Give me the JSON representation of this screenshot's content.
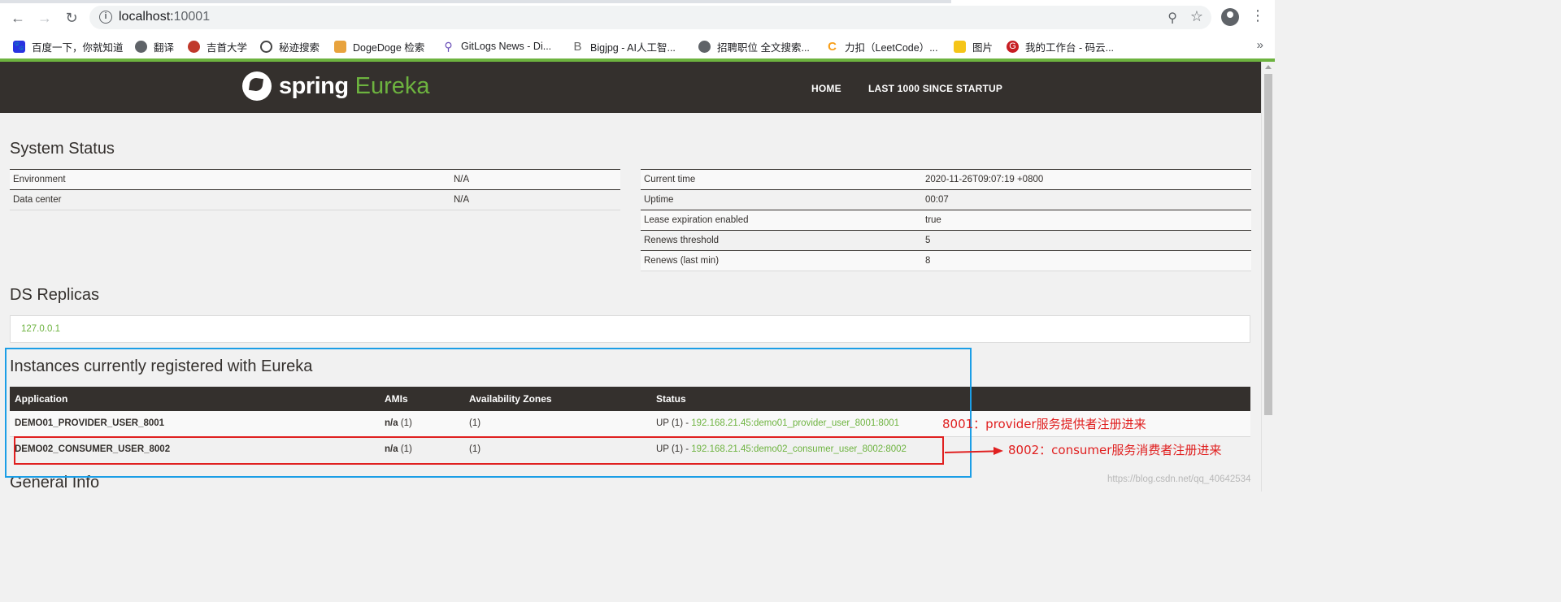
{
  "browser": {
    "url_host": "localhost:",
    "url_port": "10001",
    "bookmarks": [
      {
        "label": "百度一下，你就知道",
        "icon": "baidu-icon",
        "color": "#2932e1"
      },
      {
        "label": "翻译",
        "icon": "globe-icon",
        "color": "#5f6368"
      },
      {
        "label": "吉首大学",
        "icon": "university-icon",
        "color": "#c0392b"
      },
      {
        "label": "秘迹搜索",
        "icon": "mijisou-icon",
        "color": "#444444"
      },
      {
        "label": "DogeDoge 检索",
        "icon": "doge-icon",
        "color": "#e8a33d"
      },
      {
        "label": "GitLogs News - Di...",
        "icon": "search-icon",
        "color": "#6a4fb8"
      },
      {
        "label": "Bigjpg - AI人工智...",
        "icon": "bigjpg-icon",
        "color": "#666666"
      },
      {
        "label": "招聘职位 全文搜索...",
        "icon": "globe-icon",
        "color": "#5f6368"
      },
      {
        "label": "力扣（LeetCode）...",
        "icon": "leetcode-icon",
        "color": "#f89f1b"
      },
      {
        "label": "图片",
        "icon": "folder-icon",
        "color": "#f5c518"
      },
      {
        "label": "我的工作台 - 码云...",
        "icon": "gitee-icon",
        "color": "#c71d23"
      }
    ]
  },
  "header": {
    "brand_spring": "spring",
    "brand_eureka": "Eureka",
    "nav_home": "HOME",
    "nav_last": "LAST 1000 SINCE STARTUP"
  },
  "system_status": {
    "title": "System Status",
    "left": [
      {
        "key": "Environment",
        "value": "N/A"
      },
      {
        "key": "Data center",
        "value": "N/A"
      }
    ],
    "right": [
      {
        "key": "Current time",
        "value": "2020-11-26T09:07:19 +0800"
      },
      {
        "key": "Uptime",
        "value": "00:07"
      },
      {
        "key": "Lease expiration enabled",
        "value": "true"
      },
      {
        "key": "Renews threshold",
        "value": "5"
      },
      {
        "key": "Renews (last min)",
        "value": "8"
      }
    ]
  },
  "replicas": {
    "title": "DS Replicas",
    "link": "127.0.0.1"
  },
  "instances": {
    "title": "Instances currently registered with Eureka",
    "headers": [
      "Application",
      "AMIs",
      "Availability Zones",
      "Status"
    ],
    "rows": [
      {
        "app": "DEMO01_PROVIDER_USER_8001",
        "amis_na": "n/a",
        "amis_count": " (1)",
        "zones": "(1)",
        "status_prefix": "UP (1) - ",
        "status_link": "192.168.21.45:demo01_provider_user_8001:8001"
      },
      {
        "app": "DEMO02_CONSUMER_USER_8002",
        "amis_na": "n/a",
        "amis_count": " (1)",
        "zones": "(1)",
        "status_prefix": "UP (1) - ",
        "status_link": "192.168.21.45:demo02_consumer_user_8002:8002"
      }
    ]
  },
  "general_info": {
    "title": "General Info"
  },
  "annotations": {
    "note1": "8001：provider服务提供者注册进来",
    "note2": "8002：consumer服务消费者注册进来",
    "watermark": "https://blog.csdn.net/qq_40642534"
  }
}
